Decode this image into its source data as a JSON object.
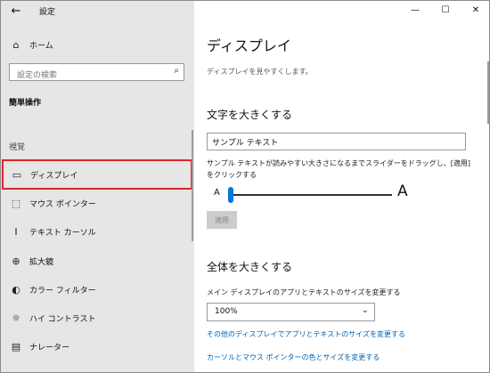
{
  "window": {
    "title": "設定",
    "back_icon": "back-arrow-icon",
    "controls": {
      "minimize": "—",
      "maximize": "☐",
      "close": "✕"
    }
  },
  "sidebar": {
    "home": {
      "icon": "⌂",
      "label": "ホーム"
    },
    "search": {
      "placeholder": "設定の検索",
      "icon": "⌕"
    },
    "section_title": "簡単操作",
    "group_title": "視覚",
    "items": [
      {
        "icon": "▭",
        "label": "ディスプレイ",
        "active": true
      },
      {
        "icon": "⬚",
        "label": "マウス ポインター"
      },
      {
        "icon": "Ⅰ",
        "label": "テキスト カーソル"
      },
      {
        "icon": "⊕",
        "label": "拡大鏡"
      },
      {
        "icon": "◐",
        "label": "カラー フィルター"
      },
      {
        "icon": "☼",
        "label": "ハイ コントラスト"
      },
      {
        "icon": "▤",
        "label": "ナレーター"
      }
    ]
  },
  "main": {
    "title": "ディスプレイ",
    "description": "ディスプレイを見やすくします。",
    "text_section": {
      "heading": "文字を大きくする",
      "sample_value": "サンプル テキスト",
      "hint": "サンプル テキストが読みやすい大きさになるまでスライダーをドラッグし、[適用] をクリックする",
      "slider_min_label": "A",
      "slider_max_label": "A",
      "slider_value": 0.0,
      "apply_label": "適用"
    },
    "all_section": {
      "heading": "全体を大きくする",
      "scale_label": "メイン ディスプレイのアプリとテキストのサイズを変更する",
      "scale_value": "100%",
      "link1": "その他のディスプレイでアプリとテキストのサイズを変更する",
      "link2": "カーソルとマウス ポインターの色とサイズを変更する"
    }
  },
  "colors": {
    "accent": "#0078d7",
    "highlight_border": "#d9252b",
    "link": "#0064b4"
  }
}
